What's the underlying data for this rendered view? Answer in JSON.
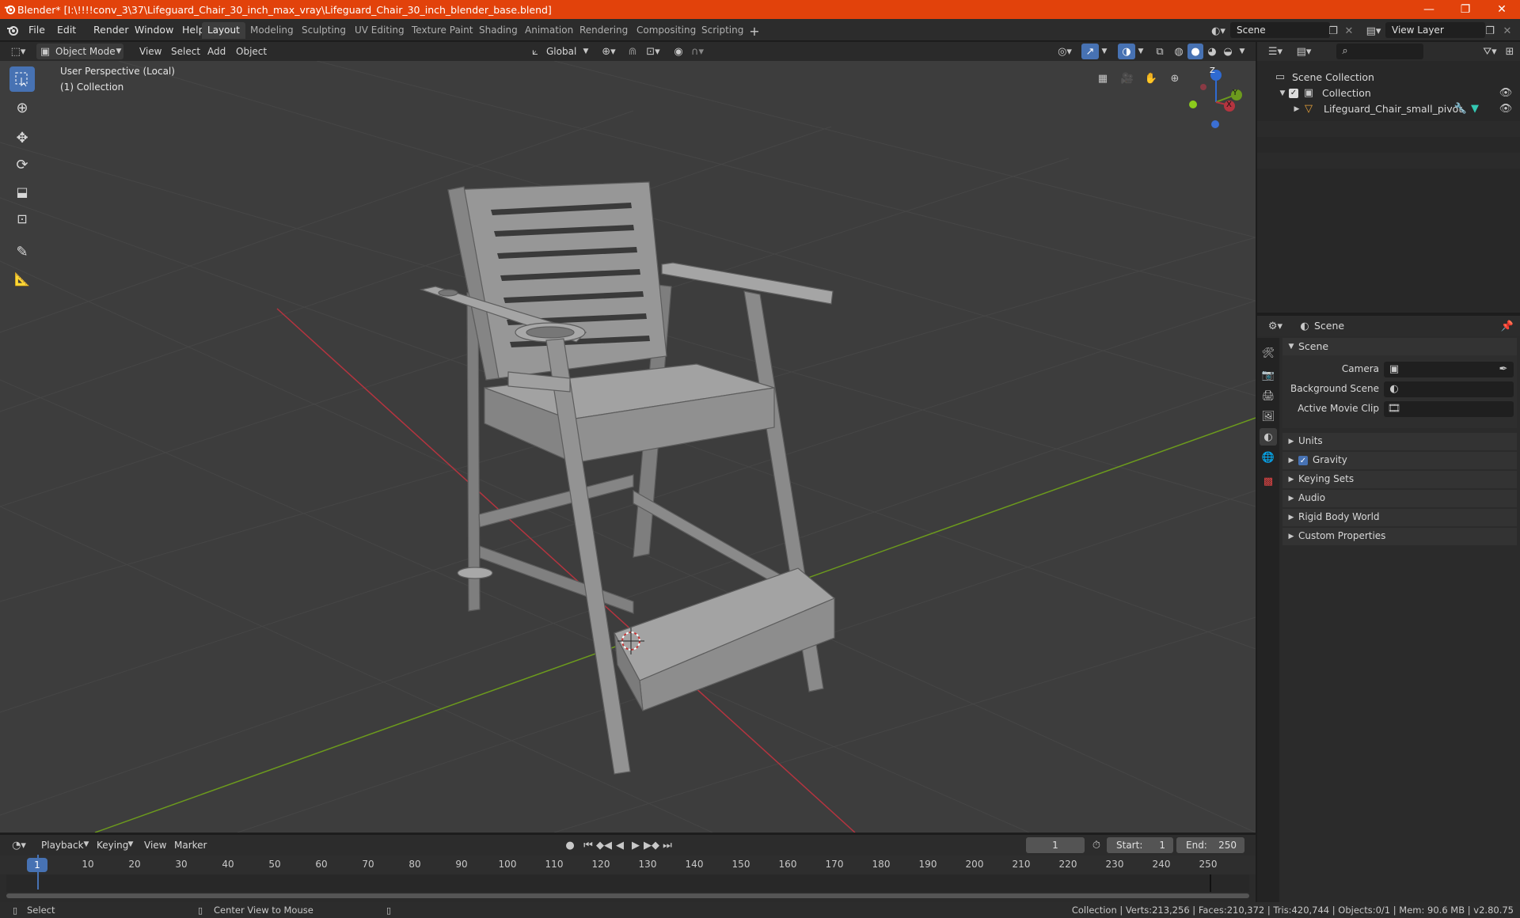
{
  "window": {
    "title": "Blender* [I:\\!!!!conv_3\\37\\Lifeguard_Chair_30_inch_max_vray\\Lifeguard_Chair_30_inch_blender_base.blend]",
    "minimize": "—",
    "maximize": "❐",
    "close": "✕"
  },
  "menu": {
    "file": "File",
    "edit": "Edit",
    "render": "Render",
    "window": "Window",
    "help": "Help"
  },
  "workspaces": [
    "Layout",
    "Modeling",
    "Sculpting",
    "UV Editing",
    "Texture Paint",
    "Shading",
    "Animation",
    "Rendering",
    "Compositing",
    "Scripting"
  ],
  "scene_field": "Scene",
  "view_layer_field": "View Layer",
  "viewport_header": {
    "mode": "Object Mode",
    "view": "View",
    "select": "Select",
    "add": "Add",
    "object": "Object",
    "orientation": "Global"
  },
  "viewport": {
    "perspective_label": "User Perspective (Local)",
    "collection_label": "(1) Collection",
    "gizmo": {
      "z": "Z",
      "y": "Y",
      "x": "X"
    }
  },
  "outliner": {
    "scene_collection": "Scene Collection",
    "collection": "Collection",
    "object": "Lifeguard_Chair_small_pivot"
  },
  "properties": {
    "header": "Scene",
    "section": "Scene",
    "camera_label": "Camera",
    "background_scene_label": "Background Scene",
    "active_movie_clip_label": "Active Movie Clip",
    "panels": [
      "Units",
      "Gravity",
      "Keying Sets",
      "Audio",
      "Rigid Body World",
      "Custom Properties"
    ],
    "gravity_checked": true
  },
  "timeline": {
    "playback": "Playback",
    "keying": "Keying",
    "view": "View",
    "marker": "Marker",
    "current_frame": "1",
    "start_label": "Start:",
    "start": "1",
    "end_label": "End:",
    "end": "250",
    "playhead": "1",
    "ticks": [
      "10",
      "20",
      "30",
      "40",
      "50",
      "60",
      "70",
      "80",
      "90",
      "100",
      "110",
      "120",
      "130",
      "140",
      "150",
      "160",
      "170",
      "180",
      "190",
      "200",
      "210",
      "220",
      "230",
      "240",
      "250"
    ]
  },
  "status": {
    "select": "Select",
    "center_view": "Center View to Mouse",
    "stats": "Collection | Verts:213,256 | Faces:210,372 | Tris:420,744 | Objects:0/1 | Mem: 90.6 MB | v2.80.75"
  },
  "colors": {
    "accent": "#4772b3",
    "titlebar": "#e2420b",
    "x_axis": "#b5343f",
    "y_axis": "#6c9a1d",
    "z_axis": "#2f6ad1"
  }
}
